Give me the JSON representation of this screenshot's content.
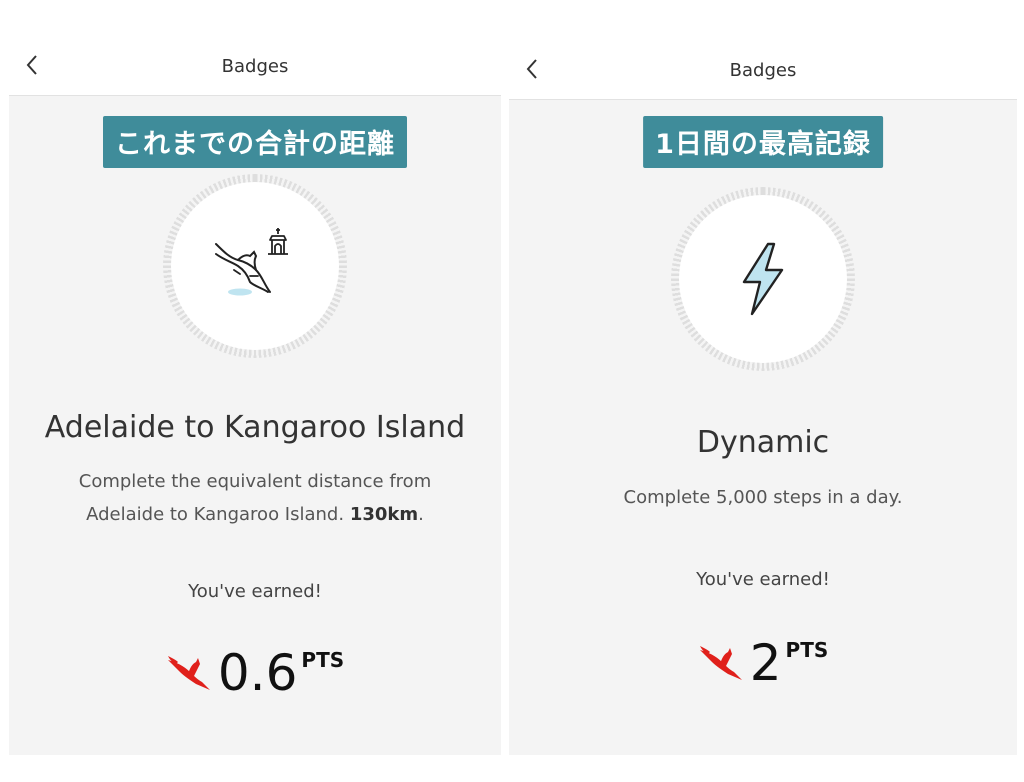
{
  "screens": [
    {
      "header_title": "Badges",
      "overlay_label": "これまでの合計の距離",
      "badge_title": "Adelaide to Kangaroo Island",
      "description_line1": "Complete the equivalent distance from",
      "description_line2": "Adelaide to Kangaroo Island.",
      "description_highlight": "130km",
      "description_end": ".",
      "earned_text": "You've earned!",
      "points_value": "0.6",
      "points_unit": "PTS",
      "icon": "kangaroo-lighthouse-icon"
    },
    {
      "header_title": "Badges",
      "overlay_label": "1日間の最高記録",
      "badge_title": "Dynamic",
      "description": "Complete 5,000 steps in a day.",
      "earned_text": "You've earned!",
      "points_value": "2",
      "points_unit": "PTS",
      "icon": "lightning-bolt-icon"
    }
  ],
  "colors": {
    "overlay_bg": "#3f8c9a",
    "brand_red": "#e0201b",
    "icon_accent": "#bfe4f0"
  }
}
